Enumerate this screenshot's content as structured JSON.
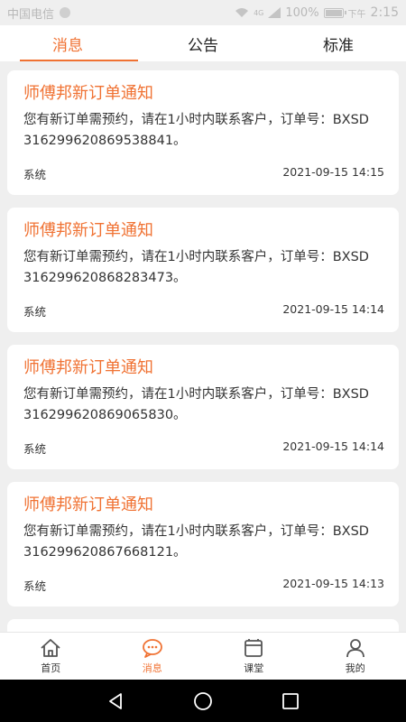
{
  "status_bar": {
    "carrier": "中国电信",
    "network_label": "4G",
    "battery": "100%",
    "time_period": "下午",
    "time": "2:15"
  },
  "tabs": [
    {
      "label": "消息",
      "active": true
    },
    {
      "label": "公告",
      "active": false
    },
    {
      "label": "标准",
      "active": false
    }
  ],
  "messages": [
    {
      "title": "师傅邦新订单通知",
      "body": "您有新订单需预约，请在1小时内联系客户，订单号：BXSD316299620869538841。",
      "source": "系统",
      "time": "2021-09-15 14:15"
    },
    {
      "title": "师傅邦新订单通知",
      "body": "您有新订单需预约，请在1小时内联系客户，订单号：BXSD316299620868283473。",
      "source": "系统",
      "time": "2021-09-15 14:14"
    },
    {
      "title": "师傅邦新订单通知",
      "body": "您有新订单需预约，请在1小时内联系客户，订单号：BXSD316299620869065830。",
      "source": "系统",
      "time": "2021-09-15 14:14"
    },
    {
      "title": "师傅邦新订单通知",
      "body": "您有新订单需预约，请在1小时内联系客户，订单号：BXSD316299620867668121。",
      "source": "系统",
      "time": "2021-09-15 14:13"
    }
  ],
  "bottom_nav": [
    {
      "label": "首页",
      "icon": "home-icon",
      "active": false
    },
    {
      "label": "消息",
      "icon": "chat-icon",
      "active": true
    },
    {
      "label": "课堂",
      "icon": "classroom-icon",
      "active": false
    },
    {
      "label": "我的",
      "icon": "profile-icon",
      "active": false
    }
  ],
  "colors": {
    "accent": "#f07233",
    "background": "#efefef",
    "text": "#333333"
  }
}
